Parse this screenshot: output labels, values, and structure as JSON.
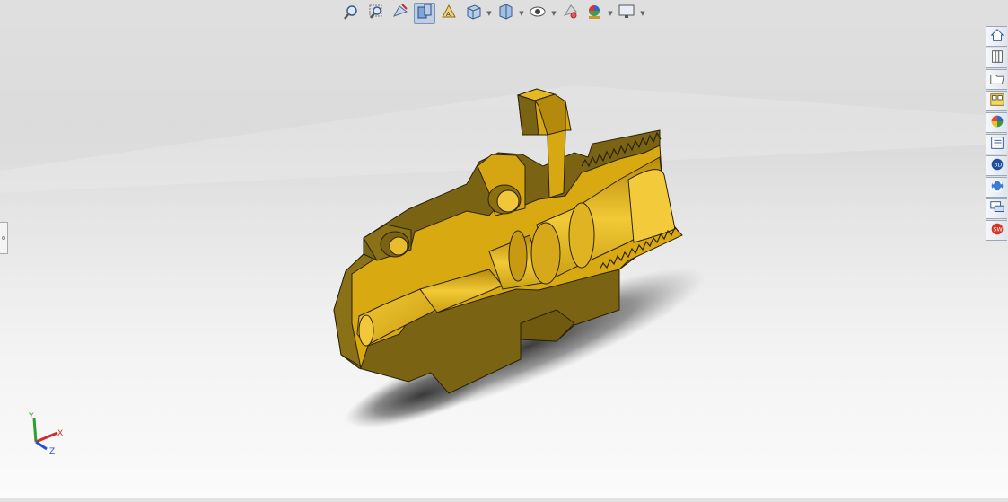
{
  "viewport": {
    "model_color": "#e0b11a",
    "background_top": "#d8d8d8",
    "background_bottom": "#fbfbfb"
  },
  "hud_toolbar": [
    {
      "name": "zoom-to-fit-icon"
    },
    {
      "name": "zoom-to-area-icon"
    },
    {
      "name": "previous-view-icon"
    },
    {
      "name": "section-view-icon",
      "active": true
    },
    {
      "name": "dynamic-annotation-icon"
    },
    {
      "name": "view-orientation-icon",
      "dropdown": true
    },
    {
      "name": "display-style-icon",
      "dropdown": true
    },
    {
      "name": "hide-show-items-icon",
      "dropdown": true
    },
    {
      "name": "edit-appearance-icon"
    },
    {
      "name": "apply-scene-icon",
      "dropdown": true
    },
    {
      "name": "view-settings-icon",
      "dropdown": true
    }
  ],
  "task_pane": [
    {
      "name": "resources-home-icon"
    },
    {
      "name": "design-library-icon"
    },
    {
      "name": "file-explorer-icon"
    },
    {
      "name": "view-palette-icon"
    },
    {
      "name": "appearances-scenes-icon"
    },
    {
      "name": "custom-properties-icon"
    },
    {
      "name": "3d-content-central-icon"
    },
    {
      "name": "sustainability-icon"
    },
    {
      "name": "forum-icon"
    },
    {
      "name": "solidworks-search-icon"
    }
  ],
  "triad": {
    "x_label": "X",
    "y_label": "Y",
    "z_label": "Z",
    "x_color": "#d12b2b",
    "y_color": "#2ca02c",
    "z_color": "#2b4fd1"
  }
}
